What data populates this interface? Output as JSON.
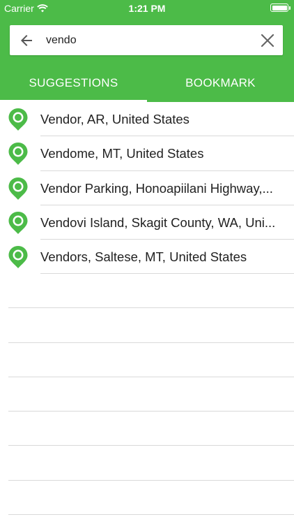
{
  "status_bar": {
    "carrier": "Carrier",
    "time": "1:21 PM"
  },
  "search": {
    "value": "vendo",
    "placeholder": "",
    "back_icon": "arrow-left-icon",
    "clear_icon": "close-icon"
  },
  "tabs": [
    {
      "label": "SUGGESTIONS",
      "active": true
    },
    {
      "label": "BOOKMARK",
      "active": false
    }
  ],
  "suggestions": [
    {
      "label": "Vendor, AR, United States",
      "icon": "location-pin-icon"
    },
    {
      "label": "Vendome, MT, United States",
      "icon": "location-pin-icon"
    },
    {
      "label": "Vendor Parking, Honoapiilani Highway,...",
      "icon": "location-pin-icon"
    },
    {
      "label": "Vendovi Island, Skagit County, WA, Uni...",
      "icon": "location-pin-icon"
    },
    {
      "label": "Vendors, Saltese, MT, United States",
      "icon": "location-pin-icon"
    }
  ],
  "colors": {
    "accent": "#4cbb48",
    "pin": "#4cbb48"
  }
}
